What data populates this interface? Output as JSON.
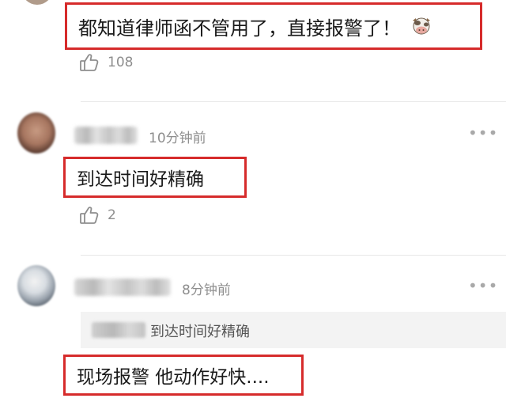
{
  "comments": [
    {
      "text": "都知道律师函不管用了，直接报警了！",
      "likes": "108",
      "emoji": "cow-face-icon"
    },
    {
      "time": "10分钟前",
      "text": "到达时间好精确",
      "likes": "2"
    },
    {
      "time": "8分钟前",
      "quote": "到达时间好精确",
      "text": "现场报警 他动作好快...."
    }
  ],
  "colors": {
    "highlight_border": "#d62b2b",
    "meta_gray": "#8e8e8e",
    "quote_bg": "#f3f3f3"
  }
}
